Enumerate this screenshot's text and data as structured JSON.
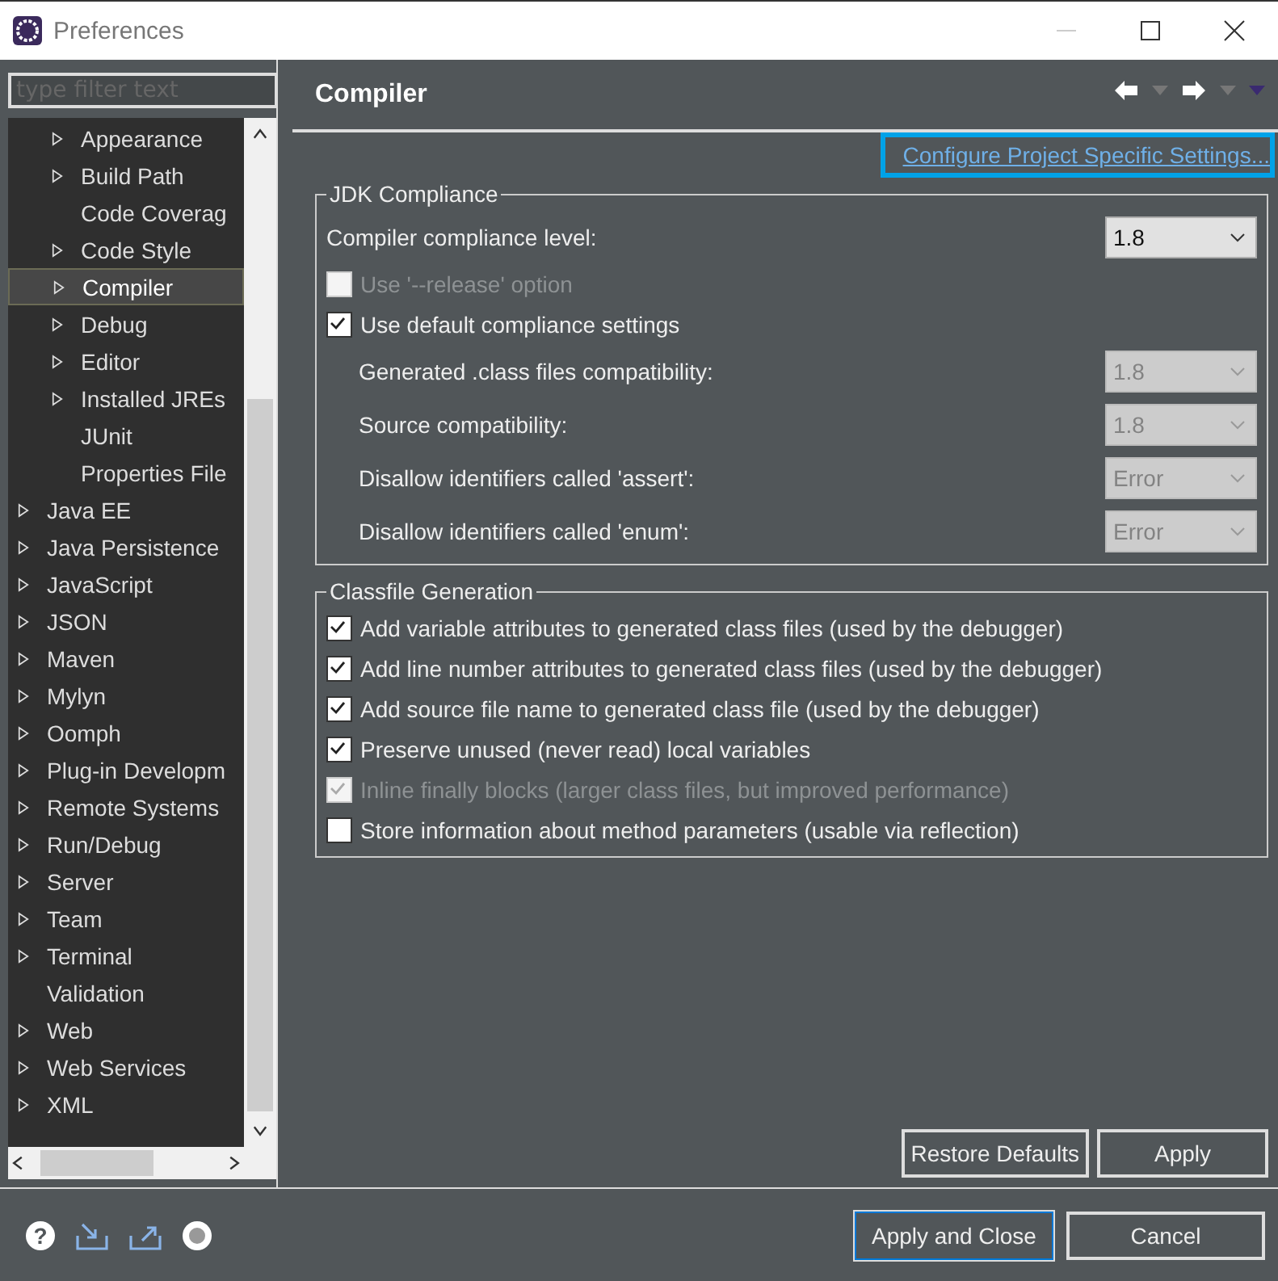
{
  "window": {
    "title": "Preferences"
  },
  "filter": {
    "placeholder": "type filter text"
  },
  "tree": [
    {
      "children": [
        {
          "label": "Appearance",
          "expandable": true,
          "selected": false
        },
        {
          "label": "Build Path",
          "expandable": true,
          "selected": false
        },
        {
          "label": "Code Coverag",
          "expandable": false,
          "selected": false
        },
        {
          "label": "Code Style",
          "expandable": true,
          "selected": false
        },
        {
          "label": "Compiler",
          "expandable": true,
          "selected": true
        },
        {
          "label": "Debug",
          "expandable": true,
          "selected": false
        },
        {
          "label": "Editor",
          "expandable": true,
          "selected": false
        },
        {
          "label": "Installed JREs",
          "expandable": true,
          "selected": false
        },
        {
          "label": "JUnit",
          "expandable": false,
          "selected": false
        },
        {
          "label": "Properties File",
          "expandable": false,
          "selected": false
        }
      ]
    },
    {
      "label": "Java EE",
      "expandable": true,
      "selected": false
    },
    {
      "label": "Java Persistence",
      "expandable": true,
      "selected": false
    },
    {
      "label": "JavaScript",
      "expandable": true,
      "selected": false
    },
    {
      "label": "JSON",
      "expandable": true,
      "selected": false
    },
    {
      "label": "Maven",
      "expandable": true,
      "selected": false
    },
    {
      "label": "Mylyn",
      "expandable": true,
      "selected": false
    },
    {
      "label": "Oomph",
      "expandable": true,
      "selected": false
    },
    {
      "label": "Plug-in Developm",
      "expandable": true,
      "selected": false
    },
    {
      "label": "Remote Systems",
      "expandable": true,
      "selected": false
    },
    {
      "label": "Run/Debug",
      "expandable": true,
      "selected": false
    },
    {
      "label": "Server",
      "expandable": true,
      "selected": false
    },
    {
      "label": "Team",
      "expandable": true,
      "selected": false
    },
    {
      "label": "Terminal",
      "expandable": true,
      "selected": false
    },
    {
      "label": "Validation",
      "expandable": false,
      "selected": false
    },
    {
      "label": "Web",
      "expandable": true,
      "selected": false
    },
    {
      "label": "Web Services",
      "expandable": true,
      "selected": false
    },
    {
      "label": "XML",
      "expandable": true,
      "selected": false
    }
  ],
  "page": {
    "title": "Compiler",
    "link": "Configure Project Specific Settings..."
  },
  "jdk": {
    "title": "JDK Compliance",
    "level_label": "Compiler compliance level:",
    "level_value": "1.8",
    "options": [
      {
        "label": "Use '--release' option",
        "checked": false,
        "disabled": true
      },
      {
        "label": "Use default compliance settings",
        "checked": true,
        "disabled": false
      }
    ],
    "settings": [
      {
        "label": "Generated .class files compatibility:",
        "value": "1.8",
        "disabled": true
      },
      {
        "label": "Source compatibility:",
        "value": "1.8",
        "disabled": true
      },
      {
        "label": "Disallow identifiers called 'assert':",
        "value": "Error",
        "disabled": true
      },
      {
        "label": "Disallow identifiers called 'enum':",
        "value": "Error",
        "disabled": true
      }
    ]
  },
  "classfile": {
    "title": "Classfile Generation",
    "options": [
      {
        "label": "Add variable attributes to generated class files (used by the debugger)",
        "checked": true,
        "disabled": false
      },
      {
        "label": "Add line number attributes to generated class files (used by the debugger)",
        "checked": true,
        "disabled": false
      },
      {
        "label": "Add source file name to generated class file (used by the debugger)",
        "checked": true,
        "disabled": false
      },
      {
        "label": "Preserve unused (never read) local variables",
        "checked": true,
        "disabled": false
      },
      {
        "label": "Inline finally blocks (larger class files, but improved performance)",
        "checked": true,
        "disabled": true
      },
      {
        "label": "Store information about method parameters (usable via reflection)",
        "checked": false,
        "disabled": false
      }
    ]
  },
  "page_buttons": [
    "Restore Defaults",
    "Apply"
  ],
  "help_glyph": "?",
  "dialog_buttons": [
    {
      "label": "Apply and Close",
      "selected": true
    },
    {
      "label": "Cancel",
      "selected": false
    }
  ]
}
